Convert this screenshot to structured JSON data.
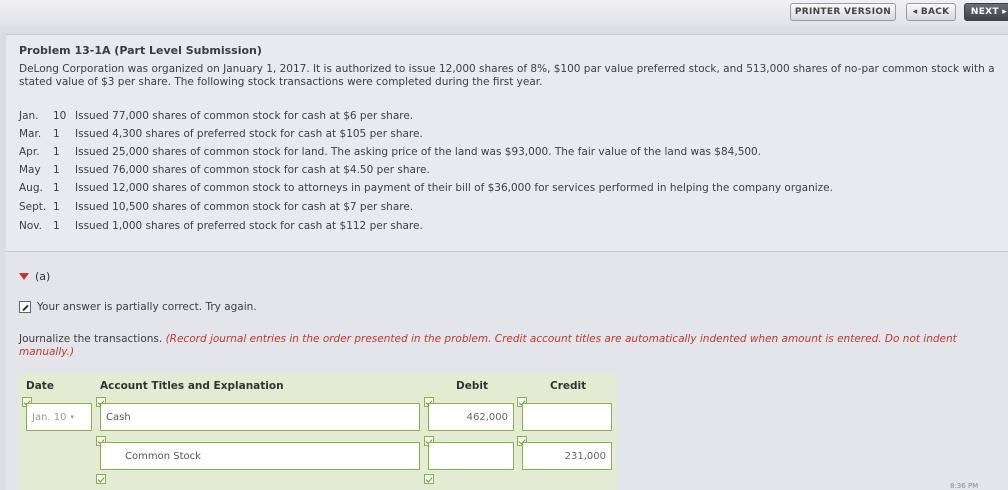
{
  "toolbar": {
    "printer_label": "PRINTER VERSION",
    "back_label": "◂ BACK",
    "next_label": "NEXT ▸"
  },
  "problem": {
    "title": "Problem 13-1A (Part Level Submission)",
    "description": "DeLong Corporation was organized on January 1, 2017. It is authorized to issue 12,000 shares of 8%, $100 par value preferred stock, and 513,000 shares of no-par common stock with a stated value of $3 per share. The following stock transactions were completed during the first year.",
    "transactions": [
      {
        "month": "Jan.",
        "day": "10",
        "text": "Issued 77,000 shares of common stock for cash at $6 per share."
      },
      {
        "month": "Mar.",
        "day": "1",
        "text": "Issued 4,300 shares of preferred stock for cash at $105 per share."
      },
      {
        "month": "Apr.",
        "day": "1",
        "text": "Issued 25,000 shares of common stock for land. The asking price of the land was $93,000. The fair value of the land was $84,500."
      },
      {
        "month": "May",
        "day": "1",
        "text": "Issued 76,000 shares of common stock for cash at $4.50 per share."
      },
      {
        "month": "Aug.",
        "day": "1",
        "text": "Issued 12,000 shares of common stock to attorneys in payment of their bill of $36,000 for services performed in helping the company organize."
      },
      {
        "month": "Sept.",
        "day": "1",
        "text": "Issued 10,500 shares of common stock for cash at $7 per share."
      },
      {
        "month": "Nov.",
        "day": "1",
        "text": "Issued 1,000 shares of preferred stock for cash at $112 per share."
      }
    ]
  },
  "section": {
    "label": "(a)",
    "status_text": "Your answer is partially correct.  Try again.",
    "instruction": "Journalize the transactions. ",
    "instruction_red": "(Record journal entries in the order presented in the problem. Credit account titles are automatically indented when amount is entered. Do not indent manually.)"
  },
  "journal": {
    "headers": {
      "date": "Date",
      "account": "Account Titles and Explanation",
      "debit": "Debit",
      "credit": "Credit"
    },
    "rows": [
      {
        "date": "Jan. 10",
        "account": "Cash",
        "debit": "462,000",
        "credit": ""
      },
      {
        "date": "",
        "account": "Common Stock",
        "debit": "",
        "credit": "231,000"
      }
    ]
  },
  "clock": "8:36 PM"
}
